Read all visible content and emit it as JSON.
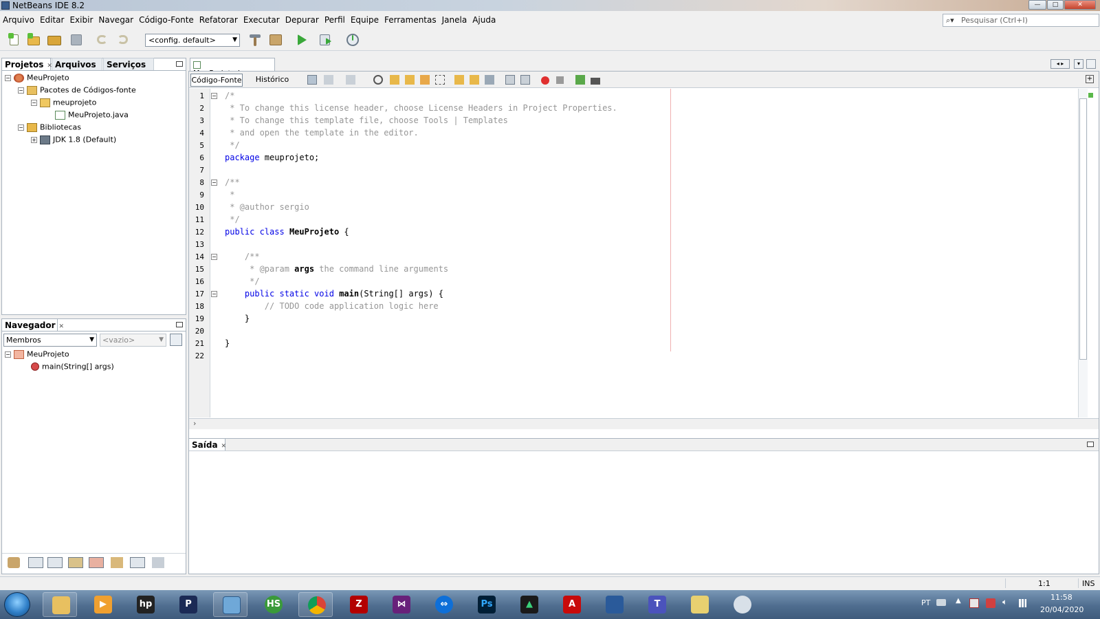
{
  "window": {
    "title": "NetBeans IDE 8.2"
  },
  "menu": [
    "Arquivo",
    "Editar",
    "Exibir",
    "Navegar",
    "Código-Fonte",
    "Refatorar",
    "Executar",
    "Depurar",
    "Perfil",
    "Equipe",
    "Ferramentas",
    "Janela",
    "Ajuda"
  ],
  "search": {
    "placeholder": "Pesquisar (Ctrl+I)"
  },
  "toolbar": {
    "config": "<config. default>"
  },
  "projects_panel": {
    "tabs": [
      "Projetos",
      "Arquivos",
      "Serviços"
    ],
    "tree": [
      "MeuProjeto",
      "Pacotes de Códigos-fonte",
      "meuprojeto",
      "MeuProjeto.java",
      "Bibliotecas",
      "JDK 1.8 (Default)"
    ]
  },
  "navigator": {
    "title": "Navegador",
    "filter": "Membros",
    "empty": "<vazio>",
    "tree": [
      "MeuProjeto",
      "main(String[] args)"
    ]
  },
  "editor": {
    "file_tab": "MeuProjeto.java",
    "view_tabs": [
      "Código-Fonte",
      "Histórico"
    ],
    "lines": [
      [
        [
          "cm",
          "/*"
        ]
      ],
      [
        [
          "cm",
          " * To change this license header, choose License Headers in Project Properties."
        ]
      ],
      [
        [
          "cm",
          " * To change this template file, choose Tools | Templates"
        ]
      ],
      [
        [
          "cm",
          " * and open the template in the editor."
        ]
      ],
      [
        [
          "cm",
          " */"
        ]
      ],
      [
        [
          "kw",
          "package"
        ],
        [
          "n",
          " meuprojeto;"
        ]
      ],
      [
        [
          "n",
          ""
        ]
      ],
      [
        [
          "cm",
          "/**"
        ]
      ],
      [
        [
          "cm",
          " *"
        ]
      ],
      [
        [
          "cm",
          " * @author sergio"
        ]
      ],
      [
        [
          "cm",
          " */"
        ]
      ],
      [
        [
          "kw",
          "public class"
        ],
        [
          "n",
          " "
        ],
        [
          "cb",
          "MeuProjeto"
        ],
        [
          "n",
          " {"
        ]
      ],
      [
        [
          "n",
          ""
        ]
      ],
      [
        [
          "cm",
          "    /**"
        ]
      ],
      [
        [
          "cm",
          "     * @param "
        ],
        [
          "cb",
          "args"
        ],
        [
          "cm",
          " the command line arguments"
        ]
      ],
      [
        [
          "cm",
          "     */"
        ]
      ],
      [
        [
          "kw",
          "    public static void"
        ],
        [
          "n",
          " "
        ],
        [
          "cb",
          "main"
        ],
        [
          "n",
          "(String[] args) {"
        ]
      ],
      [
        [
          "cm",
          "        // TODO code application logic here"
        ]
      ],
      [
        [
          "n",
          "    }"
        ]
      ],
      [
        [
          "n",
          ""
        ]
      ],
      [
        [
          "n",
          "}"
        ]
      ],
      [
        [
          "n",
          ""
        ]
      ]
    ]
  },
  "output": {
    "title": "Saída"
  },
  "status": {
    "position": "1:1",
    "mode": "INS"
  },
  "tray": {
    "lang": "PT",
    "time": "11:58",
    "date": "20/04/2020"
  },
  "taskbar": {
    "icons": [
      "start-orb",
      "explorer",
      "media-player",
      "hp",
      "p-app",
      "cube-app",
      "hs",
      "chrome",
      "filezilla",
      "visual-studio",
      "teamviewer",
      "photoshop",
      "media",
      "acrobat",
      "app-box",
      "teams",
      "folder",
      "paint"
    ]
  }
}
